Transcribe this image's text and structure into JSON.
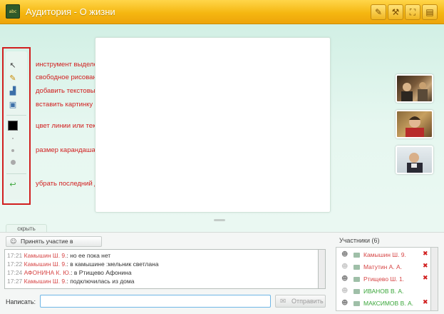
{
  "header": {
    "title": "Аудитория - О жизни",
    "logo_text": "abc",
    "buttons": [
      {
        "icon": "pencil-icon",
        "glyph": "✎"
      },
      {
        "icon": "wrench-icon",
        "glyph": "⚒"
      },
      {
        "icon": "fullscreen-icon",
        "glyph": "⛶"
      },
      {
        "icon": "document-icon",
        "glyph": "▤"
      }
    ]
  },
  "tools": [
    {
      "icon": "select-cursor-icon",
      "glyph": "↖"
    },
    {
      "icon": "pencil-icon",
      "glyph": "✎"
    },
    {
      "icon": "text-block-icon",
      "glyph": "▟"
    },
    {
      "icon": "image-icon",
      "glyph": "▣"
    },
    {
      "icon": "undo-icon",
      "glyph": "↩"
    }
  ],
  "annotations": {
    "select": "инструмент выделения/изменения",
    "draw": "свободное рисование \"карандашом\"",
    "text": "добавить текстовый блок",
    "image": "вставить картинку",
    "color": "цвет линии или текста",
    "size": "размер карандаша или текста",
    "undo": "убрать последний добавленный объект"
  },
  "colors": {
    "accent": "#f5b711",
    "annotation": "#d11f1f",
    "chat_name": "#d64545",
    "participant_red": "#d64545",
    "participant_green": "#3aa63a"
  },
  "bottom": {
    "hide_tab": "скрыть",
    "join_video": "Принять участие в видеочате",
    "write_label": "Написать:",
    "send_button": "Отправить",
    "participants_title": "Участники (6)"
  },
  "chat": [
    {
      "time": "17:21",
      "name": "Камышин Ш. 9.",
      "text": ": но ее пока нет"
    },
    {
      "time": "17:22",
      "name": "Камышин Ш. 9.",
      "text": ": в камышине :мельник светлана"
    },
    {
      "time": "17:24",
      "name": "АФОНИНА К. Ю.",
      "text": ": в Ртищево Афонина"
    },
    {
      "time": "17:27",
      "name": "Камышин Ш. 9.",
      "text": ": подключилась из дома"
    }
  ],
  "participants": [
    {
      "name": "Камышин Ш. 9.",
      "color": "red",
      "removable": true
    },
    {
      "name": "Матутин А. А.",
      "color": "red",
      "removable": true
    },
    {
      "name": "Ртищево Ш. 1.",
      "color": "red",
      "removable": true
    },
    {
      "name": "ИВАНОВ В. А.",
      "color": "green",
      "removable": false
    },
    {
      "name": "МАКСИМОВ В. А.",
      "color": "green",
      "removable": true
    }
  ]
}
